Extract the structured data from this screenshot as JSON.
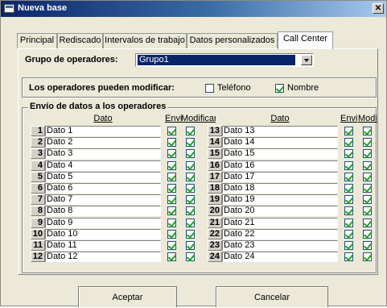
{
  "window": {
    "title": "Nueva base"
  },
  "tabs": [
    "Principal",
    "Rediscado",
    "Intervalos de trabajo",
    "Datos personalizados",
    "Call Center"
  ],
  "grupo": {
    "label": "Grupo de operadores:",
    "value": "Grupo1"
  },
  "modificar": {
    "label": "Los operadores pueden modificar:",
    "telefono": {
      "label": "Teléfono",
      "checked": false
    },
    "nombre": {
      "label": "Nombre",
      "checked": true
    }
  },
  "envio": {
    "legend": "Envío de datos a los operadores",
    "col_dato": "Dato",
    "col_envio": "Envi",
    "col_modificar": "Modificar",
    "col_modificar_right": "Modi",
    "rows": [
      {
        "num": "1",
        "label": "Dato 1"
      },
      {
        "num": "2",
        "label": "Dato 2"
      },
      {
        "num": "3",
        "label": "Dato 3"
      },
      {
        "num": "4",
        "label": "Dato 4"
      },
      {
        "num": "5",
        "label": "Dato 5"
      },
      {
        "num": "6",
        "label": "Dato 6"
      },
      {
        "num": "7",
        "label": "Dato 7"
      },
      {
        "num": "8",
        "label": "Dato 8"
      },
      {
        "num": "9",
        "label": "Dato 9"
      },
      {
        "num": "10",
        "label": "Dato 10"
      },
      {
        "num": "11",
        "label": "Dato 11"
      },
      {
        "num": "12",
        "label": "Dato 12"
      },
      {
        "num": "13",
        "label": "Dato 13"
      },
      {
        "num": "14",
        "label": "Dato 14"
      },
      {
        "num": "15",
        "label": "Dato 15"
      },
      {
        "num": "16",
        "label": "Dato 16"
      },
      {
        "num": "17",
        "label": "Dato 17"
      },
      {
        "num": "18",
        "label": "Dato 18"
      },
      {
        "num": "19",
        "label": "Dato 19"
      },
      {
        "num": "20",
        "label": "Dato 20"
      },
      {
        "num": "21",
        "label": "Dato 21"
      },
      {
        "num": "22",
        "label": "Dato 22"
      },
      {
        "num": "23",
        "label": "Dato 23"
      },
      {
        "num": "24",
        "label": "Dato 24"
      }
    ]
  },
  "buttons": {
    "aceptar": "Aceptar",
    "cancelar": "Cancelar"
  }
}
